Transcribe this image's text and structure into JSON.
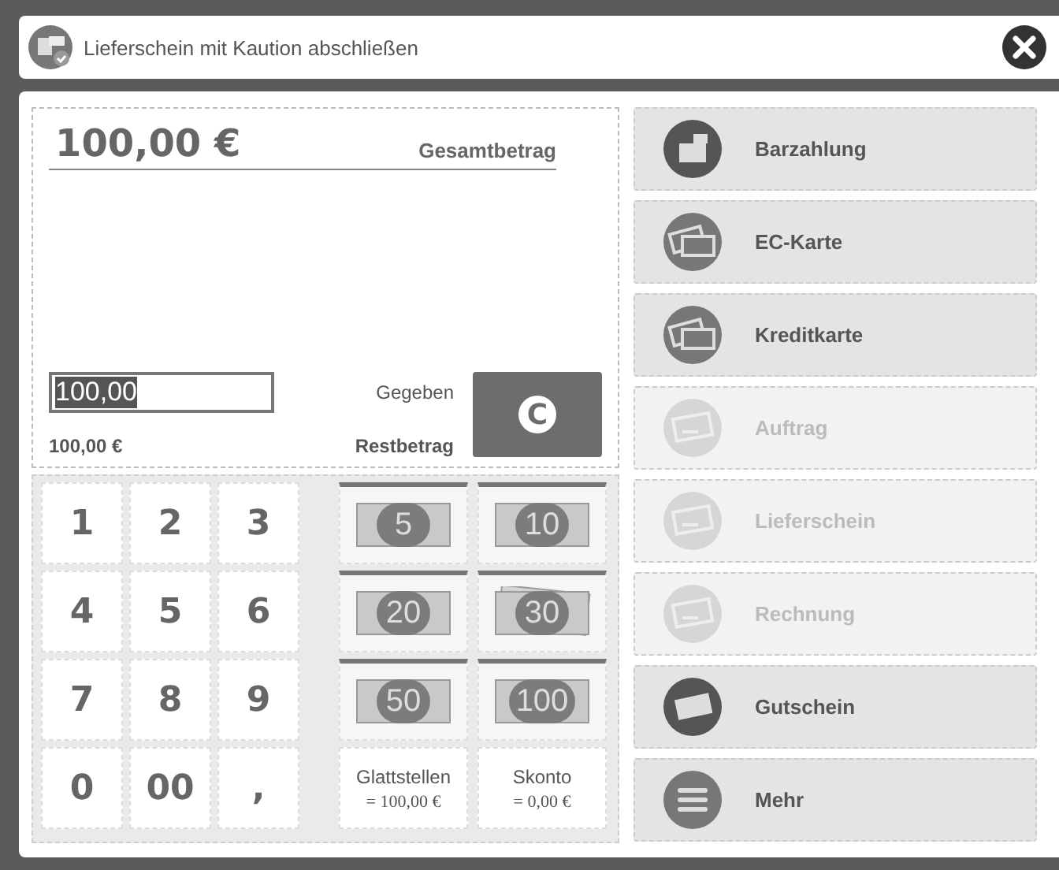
{
  "window": {
    "title": "Lieferschein mit Kaution abschließen"
  },
  "summary": {
    "total": "100,00 €",
    "total_label": "Gesamtbetrag",
    "given_value": "100,00",
    "given_value_selected": true,
    "given_label": "Gegeben",
    "remaining": "100,00 €",
    "remaining_label": "Restbetrag",
    "clear_key": "C"
  },
  "keypad": [
    "1",
    "2",
    "3",
    "4",
    "5",
    "6",
    "7",
    "8",
    "9",
    "0",
    "00",
    ","
  ],
  "banknotes": [
    {
      "label": "5",
      "kind": "note"
    },
    {
      "label": "10",
      "kind": "note"
    },
    {
      "label": "20",
      "kind": "note"
    },
    {
      "label": "30",
      "kind": "stack"
    },
    {
      "label": "50",
      "kind": "note"
    },
    {
      "label": "100",
      "kind": "note"
    }
  ],
  "actions": [
    {
      "label": "Glattstellen",
      "value": "= 100,00 €"
    },
    {
      "label": "Skonto",
      "value": "= 0,00 €"
    }
  ],
  "payment_methods": [
    {
      "label": "Barzahlung",
      "kind": "register",
      "disabled": false
    },
    {
      "label": "EC-Karte",
      "kind": "card",
      "disabled": false
    },
    {
      "label": "Kreditkarte",
      "kind": "card",
      "disabled": false
    },
    {
      "label": "Auftrag",
      "kind": "document",
      "disabled": true
    },
    {
      "label": "Lieferschein",
      "kind": "document",
      "disabled": true
    },
    {
      "label": "Rechnung",
      "kind": "document",
      "disabled": true
    },
    {
      "label": "Gutschein",
      "kind": "voucher",
      "disabled": false
    },
    {
      "label": "Mehr",
      "kind": "menu",
      "disabled": false
    }
  ]
}
